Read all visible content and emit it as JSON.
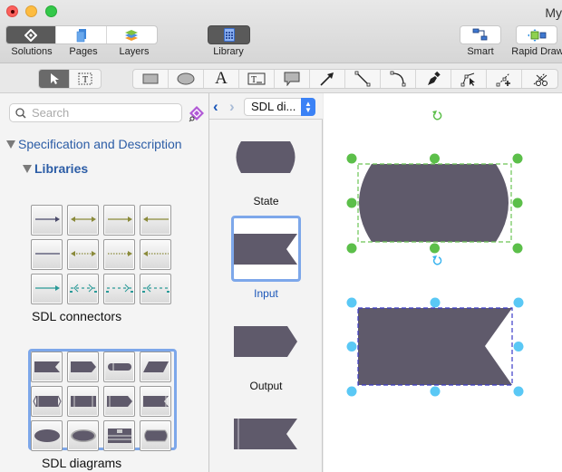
{
  "window": {
    "title": "My"
  },
  "toolbar": {
    "left_segment": [
      {
        "label": "Solutions",
        "icon": "solutions-icon",
        "active": true
      },
      {
        "label": "Pages",
        "icon": "pages-icon",
        "active": false
      },
      {
        "label": "Layers",
        "icon": "layers-icon",
        "active": false
      }
    ],
    "library": {
      "label": "Library",
      "icon": "library-icon",
      "active": true
    },
    "smart": {
      "label": "Smart",
      "icon": "smart-connector-icon"
    },
    "rapid_draw": {
      "label": "Rapid Draw",
      "icon": "rapid-draw-icon"
    }
  },
  "tools": {
    "mode_group": [
      {
        "name": "select-tool",
        "icon": "pointer-icon",
        "selected": true
      },
      {
        "name": "text-select-tool",
        "icon": "text-frame-icon",
        "selected": false
      }
    ],
    "draw_group": [
      {
        "name": "rectangle-tool",
        "icon": "rectangle-icon"
      },
      {
        "name": "ellipse-tool",
        "icon": "ellipse-icon"
      },
      {
        "name": "text-tool",
        "icon": "text-icon",
        "glyph": "A"
      },
      {
        "name": "text-block-tool",
        "icon": "text-block-icon"
      },
      {
        "name": "callout-tool",
        "icon": "callout-icon"
      },
      {
        "name": "arrow-tool",
        "icon": "arrow-icon"
      },
      {
        "name": "line-tool",
        "icon": "line-icon"
      },
      {
        "name": "arc-tool",
        "icon": "arc-icon"
      },
      {
        "name": "pen-tool",
        "icon": "pen-icon"
      },
      {
        "name": "direct-select-tool",
        "icon": "bezier-select-icon"
      },
      {
        "name": "add-point-tool",
        "icon": "add-point-icon"
      },
      {
        "name": "scissors-tool",
        "icon": "scissors-icon"
      }
    ]
  },
  "sidebar": {
    "search_placeholder": "Search",
    "tree": {
      "solution": "Specification and Description",
      "folder": "Libraries"
    },
    "libraries": [
      {
        "label": "SDL connectors",
        "selected": false,
        "items": [
          "solid-arrow-right",
          "double-arrow",
          "arrow-right",
          "arrow-left",
          "plain-line",
          "dotted-double-arrow",
          "dotted-arrow-right",
          "dotted-arrow-left",
          "teal-arrow-right",
          "teal-dashed-double",
          "teal-dashed-right",
          "teal-dashed-left"
        ]
      },
      {
        "label": "SDL diagrams",
        "selected": true,
        "items": [
          "input",
          "output",
          "terminator",
          "parallelogram",
          "procedure",
          "process",
          "output-alt",
          "input-alt",
          "ellipse",
          "double-ellipse",
          "text-block",
          "state"
        ]
      }
    ]
  },
  "library_panel": {
    "selected_library": "SDL di...",
    "shapes": [
      {
        "label": "State",
        "selected": false
      },
      {
        "label": "Input",
        "selected": true
      },
      {
        "label": "Output",
        "selected": false
      },
      {
        "label": "",
        "selected": false
      }
    ]
  },
  "canvas": {
    "shape_fill": "#5f5a6b",
    "objects": [
      {
        "type": "state",
        "handle_color": "#5cbf4a",
        "selected": true
      },
      {
        "type": "input",
        "handle_color": "#5ac8f5",
        "selected": true
      }
    ]
  }
}
